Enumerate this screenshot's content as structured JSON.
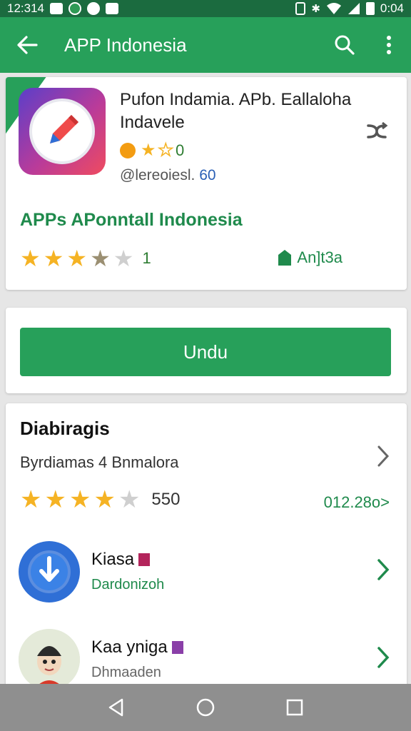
{
  "status_bar": {
    "time_left": "12:314",
    "time_right": "0:04",
    "icons_left": [
      "photo-icon",
      "whatsapp-icon",
      "clock-icon",
      "gallery-icon"
    ],
    "icons_right": [
      "vibrate-icon",
      "bluetooth-icon",
      "wifi-icon",
      "signal-icon",
      "battery-icon"
    ]
  },
  "app_bar": {
    "title": "APP Indonesia",
    "back_icon": "arrow-left-icon",
    "search_icon": "search-icon",
    "menu_icon": "more-vert-icon",
    "color": "#27a05a"
  },
  "header": {
    "app_name": "Pufon Indamia. APb. Eallaloha Indavele",
    "mini_rating_value": "0",
    "developer_label": "@lereoiesl.",
    "developer_num": "60",
    "category": "APPs APonntall Indonesia",
    "rating_count": "1",
    "badge_text": "An]t3a",
    "share_icon": "share-icon"
  },
  "install": {
    "button_label": "Undu"
  },
  "similar": {
    "title": "Diabiragis",
    "subtitle": "Byrdiamas 4 Bnmalora",
    "rating_count": "550",
    "link_text": "012.28o>",
    "items": [
      {
        "name": "Kiasa",
        "sub": "Dardonizoh",
        "icon": "download-icon"
      },
      {
        "name": "Kaa yniga",
        "sub": "Dhmaaden",
        "icon": "avatar-icon"
      }
    ]
  },
  "nav": {
    "back": "nav-back-icon",
    "home": "nav-home-icon",
    "recents": "nav-recents-icon"
  },
  "colors": {
    "primary": "#27a05a",
    "primary_dark": "#1b6b3f",
    "star": "#f5b324",
    "accent_text": "#1f8a4c"
  }
}
